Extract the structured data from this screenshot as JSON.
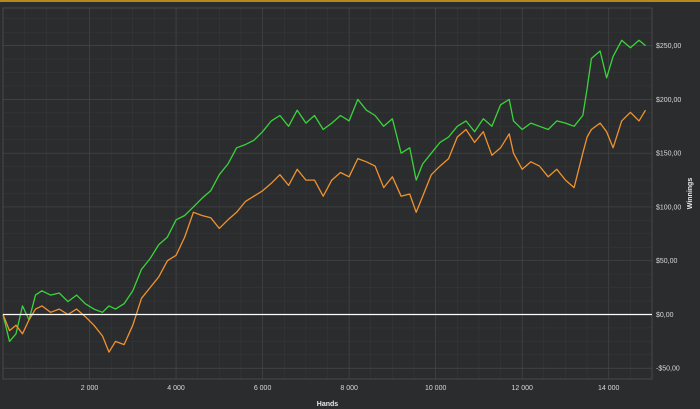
{
  "chart_data": {
    "type": "line",
    "title": "",
    "xlabel": "Hands",
    "ylabel": "Winnings",
    "xlim": [
      0,
      15000
    ],
    "ylim": [
      -60,
      285
    ],
    "x_ticks": [
      2000,
      4000,
      6000,
      8000,
      10000,
      12000,
      14000
    ],
    "x_tick_labels": [
      "2 000",
      "4 000",
      "6 000",
      "8 000",
      "10 000",
      "12 000",
      "14 000"
    ],
    "y_ticks": [
      -50,
      0,
      50,
      100,
      150,
      200,
      250
    ],
    "y_tick_labels": [
      "-$50,00",
      "$0,00",
      "$50,00",
      "$100,00",
      "$150,00",
      "$200,00",
      "$250,00"
    ],
    "grid": true,
    "zero_line": 0,
    "colors": {
      "background": "#2b2c2e",
      "grid": "#454749",
      "zero_line": "#ffffff",
      "top_border": "#b58a1a"
    },
    "series": [
      {
        "color": "#3ad43a",
        "x": [
          0,
          150,
          300,
          450,
          600,
          750,
          900,
          1100,
          1300,
          1500,
          1700,
          1900,
          2100,
          2300,
          2450,
          2600,
          2800,
          3000,
          3200,
          3400,
          3600,
          3800,
          4000,
          4200,
          4400,
          4600,
          4800,
          5000,
          5200,
          5400,
          5600,
          5800,
          6000,
          6200,
          6400,
          6600,
          6800,
          7000,
          7200,
          7400,
          7600,
          7800,
          8000,
          8200,
          8400,
          8600,
          8800,
          9000,
          9200,
          9400,
          9550,
          9700,
          9900,
          10100,
          10300,
          10500,
          10700,
          10900,
          11100,
          11300,
          11500,
          11700,
          11800,
          12000,
          12200,
          12400,
          12600,
          12800,
          13000,
          13200,
          13400,
          13500,
          13600,
          13800,
          13950,
          14100,
          14300,
          14500,
          14700,
          14850
        ],
        "y": [
          0,
          -25,
          -18,
          8,
          -5,
          18,
          22,
          18,
          20,
          12,
          18,
          10,
          5,
          2,
          8,
          5,
          10,
          22,
          42,
          52,
          65,
          72,
          88,
          92,
          100,
          108,
          115,
          130,
          140,
          155,
          158,
          162,
          170,
          180,
          185,
          175,
          190,
          178,
          185,
          172,
          178,
          185,
          180,
          200,
          190,
          185,
          175,
          182,
          150,
          155,
          125,
          140,
          150,
          160,
          165,
          175,
          180,
          170,
          182,
          175,
          195,
          200,
          180,
          172,
          178,
          175,
          172,
          180,
          178,
          175,
          185,
          210,
          238,
          245,
          220,
          240,
          255,
          248,
          255,
          250
        ]
      },
      {
        "color": "#f0922e",
        "x": [
          0,
          150,
          300,
          450,
          600,
          750,
          900,
          1100,
          1300,
          1500,
          1700,
          1900,
          2100,
          2300,
          2450,
          2600,
          2800,
          3000,
          3200,
          3400,
          3600,
          3800,
          4000,
          4200,
          4400,
          4600,
          4800,
          5000,
          5200,
          5400,
          5600,
          5800,
          6000,
          6200,
          6400,
          6600,
          6800,
          7000,
          7200,
          7400,
          7600,
          7800,
          8000,
          8200,
          8400,
          8600,
          8800,
          9000,
          9200,
          9400,
          9550,
          9700,
          9900,
          10100,
          10300,
          10500,
          10700,
          10900,
          11100,
          11300,
          11500,
          11700,
          11800,
          12000,
          12200,
          12400,
          12600,
          12800,
          13000,
          13200,
          13400,
          13500,
          13600,
          13800,
          13950,
          14100,
          14300,
          14500,
          14700,
          14850
        ],
        "y": [
          0,
          -15,
          -10,
          -18,
          -5,
          5,
          8,
          2,
          5,
          0,
          5,
          -2,
          -10,
          -20,
          -35,
          -25,
          -28,
          -10,
          15,
          25,
          35,
          50,
          55,
          72,
          95,
          92,
          90,
          80,
          88,
          95,
          105,
          110,
          115,
          122,
          130,
          120,
          135,
          125,
          125,
          110,
          125,
          132,
          128,
          145,
          142,
          138,
          118,
          128,
          110,
          112,
          95,
          110,
          130,
          138,
          145,
          165,
          172,
          160,
          170,
          148,
          155,
          168,
          150,
          135,
          142,
          138,
          128,
          135,
          125,
          118,
          150,
          165,
          172,
          178,
          170,
          155,
          180,
          188,
          180,
          190
        ]
      }
    ]
  }
}
